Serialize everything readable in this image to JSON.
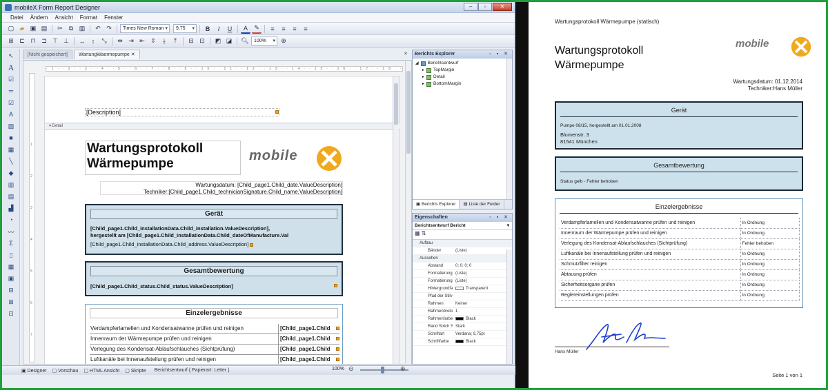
{
  "designer": {
    "window_title": "mobileX Form Report Designer",
    "menu": [
      "Datei",
      "Ändern",
      "Ansicht",
      "Format",
      "Fenster"
    ],
    "font_name": "Times New Roman",
    "font_size": "9,75",
    "zoom_combo": "100%",
    "tabs": [
      "[Nicht gespeichert]",
      "WartungWaermepumpe"
    ],
    "band_detail": "Detail",
    "description_field": "[Description]",
    "title_line1": "Wartungsprotokoll",
    "title_line2": "Wärmepumpe",
    "logo_text": "mobile",
    "date_line": "Wartungsdatum: [Child_page1.Child_date.ValueDescription]",
    "tech_line": "Techniker:[Child_page1.Child_technicianSignature.Child_name.ValueDescription]",
    "geraet_header": "Gerät",
    "geraet_field1": "[Child_page1.Child_installationData.Child_installation.ValueDescription],",
    "geraet_field2": "hergestellt am [Child_page1.Child_installationData.Child_dateOfManufacture.Val",
    "geraet_field3": "[Child_page1.Child_installationData.Child_address.ValueDescription]",
    "gesamt_header": "Gesamtbewertung",
    "gesamt_field": "[Child_page1.Child_status.Child_status.ValueDescription]",
    "einzel_header": "Einzelergebnisse",
    "einzel_rows": [
      {
        "label": "Verdampferlamellen und Kondensatwanne prüfen und reinigen",
        "value": "[Child_page1.Child"
      },
      {
        "label": "Innenraum der Wärmepumpe prüfen und reinigen",
        "value": "[Child_page1.Child"
      },
      {
        "label": "Verlegung des Kondensat-Ablaufschlauches (Sichtprüfung)",
        "value": "[Child_page1.Child"
      },
      {
        "label": "Luftkanäle bei Innenaufstellung prüfen und reinigen",
        "value": "[Child_page1.Child"
      }
    ],
    "statusbar": {
      "designer": "Designer",
      "vorschau": "Vorschau",
      "html": "HTML Ansicht",
      "skripte": "Skripte",
      "info": "Berichtsentwurf { Papierart: Letter }",
      "zoom": "100%"
    }
  },
  "explorer": {
    "title": "Berichts Explorer",
    "root": "Berichtsentwurf",
    "items": [
      "TopMargin",
      "Detail",
      "BottomMargin"
    ],
    "tab_explorer": "Berichts Explorer",
    "tab_fields": "Liste der Felder"
  },
  "properties": {
    "title": "Eigenschaften",
    "object": "Berichtsentwurf",
    "object_type": "Bericht",
    "categories": [
      {
        "name": "Aufbau",
        "props": [
          {
            "name": "Bänder",
            "value": "(Liste)"
          }
        ]
      },
      {
        "name": "Aussehen",
        "props": [
          {
            "name": "Abstand",
            "value": "0; 0; 0; 0"
          },
          {
            "name": "Formatierungsr",
            "value": "(Liste)"
          },
          {
            "name": "Formatierungsr",
            "value": "(Liste)"
          },
          {
            "name": "Hintergrundfarb",
            "value": "Transparent"
          },
          {
            "name": "Pfad der Stilvorl",
            "value": ""
          },
          {
            "name": "Rahmen",
            "value": "Keiner"
          },
          {
            "name": "Rahmenbreite",
            "value": "1"
          },
          {
            "name": "Rahmenfarbe",
            "value": "Black"
          },
          {
            "name": "Rand Strich Stil",
            "value": "Stark"
          },
          {
            "name": "Schriftart",
            "value": "Verdana; 9,75pt"
          },
          {
            "name": "Schriftfarbe",
            "value": "Black"
          }
        ]
      }
    ]
  },
  "preview": {
    "header": "Wartungsprotokoll Wärmepumpe (statisch)",
    "title_line1": "Wartungsprotokoll",
    "title_line2": "Wärmepumpe",
    "logo_text": "mobile",
    "date": "Wartungsdatum: 01.12.2014",
    "technician": "Techniker:Hans Müller",
    "geraet_header": "Gerät",
    "geraet_line1": "Pumpe 08/15, hergestellt am 01.01.2008",
    "geraet_line2": "Blumenstr. 3",
    "geraet_line3": "81541 München",
    "gesamt_header": "Gesamtbewertung",
    "gesamt_value": "Status gelb - Fehler behoben",
    "einzel_header": "Einzelergebnisse",
    "einzel_rows": [
      {
        "label": "Verdampferlamellen und Kondensatwanne prüfen und reinigen",
        "value": "In Ordnung"
      },
      {
        "label": "Innenraum der Wärmepumpe prüfen und reinigen",
        "value": "In Ordnung"
      },
      {
        "label": "Verlegung des Kondensat-Ablaufschlauches (Sichtprüfung)",
        "value": "Fehler behoben"
      },
      {
        "label": "Luftkanäle bei Innenaufstellung prüfen und reinigen",
        "value": "In Ordnung"
      },
      {
        "label": "Schmutzfilter reinigen",
        "value": "In Ordnung"
      },
      {
        "label": "Abtauung prüfen",
        "value": "In Ordnung"
      },
      {
        "label": "Sicherheitsorgane prüfen",
        "value": "In Ordnung"
      },
      {
        "label": "Reglereinstellungen prüfen",
        "value": "In Ordnung"
      }
    ],
    "signer": "Hans Müller",
    "page_info": "Seite 1 von 1"
  },
  "colors": {
    "frame": "#1fa03a",
    "band_blue": "#cfe0ea",
    "logo_orange": "#f0a81c",
    "logo_gray": "#6b6b6b"
  }
}
